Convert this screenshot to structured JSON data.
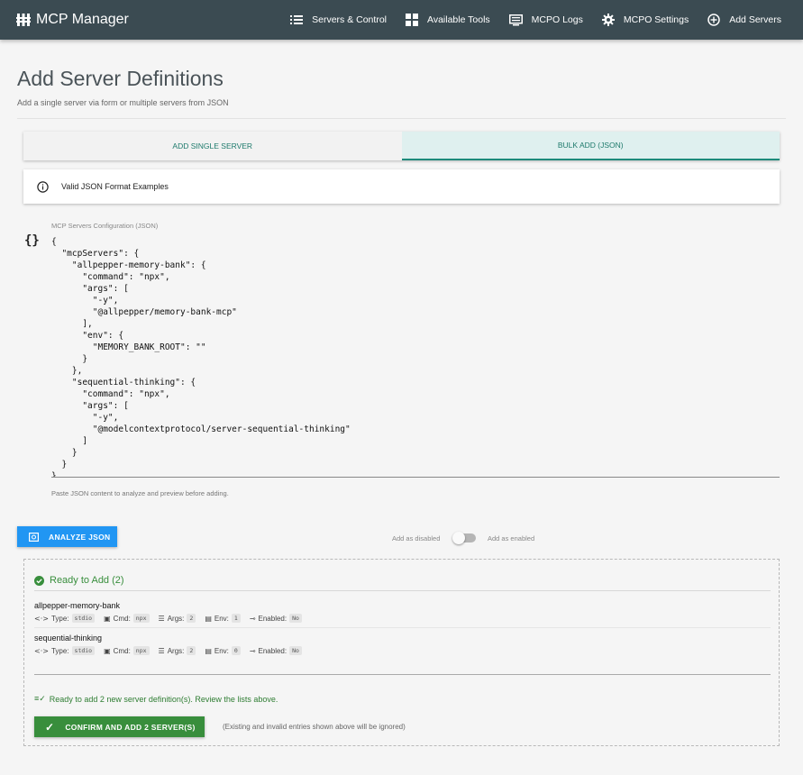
{
  "app": {
    "title": "MCP Manager"
  },
  "nav": [
    {
      "label": "Servers & Control",
      "icon": "list-icon"
    },
    {
      "label": "Available Tools",
      "icon": "widgets-icon"
    },
    {
      "label": "MCPO Logs",
      "icon": "logs-icon"
    },
    {
      "label": "MCPO Settings",
      "icon": "gear-icon"
    },
    {
      "label": "Add Servers",
      "icon": "add-circle-icon"
    }
  ],
  "page": {
    "title": "Add Server Definitions",
    "subtitle": "Add a single server via form or multiple servers from JSON"
  },
  "tabs": [
    {
      "label": "ADD SINGLE SERVER",
      "active": false
    },
    {
      "label": "BULK ADD (JSON)",
      "active": true
    }
  ],
  "info": {
    "text": "Valid JSON Format Examples"
  },
  "json_editor": {
    "label": "MCP Servers Configuration (JSON)",
    "hint": "Paste JSON content to analyze and preview before adding.",
    "lines": [
      "{",
      "  \"mcpServers\": {",
      "    \"allpepper-memory-bank\": {",
      "      \"command\": \"npx\",",
      "      \"args\": [",
      "        \"-y\",",
      "        \"@allpepper/memory-bank-mcp\"",
      "      ],",
      "      \"env\": {",
      "        \"MEMORY_BANK_ROOT\": \"\"",
      "      }",
      "    },",
      "    \"sequential-thinking\": {",
      "      \"command\": \"npx\",",
      "      \"args\": [",
      "        \"-y\",",
      "        \"@modelcontextprotocol/server-sequential-thinking\"",
      "      ]",
      "    }",
      "  }",
      "}"
    ]
  },
  "analyze": {
    "button_label": "ANALYZE JSON",
    "toggle_left": "Add as disabled",
    "toggle_right": "Add as enabled"
  },
  "preview": {
    "title": "Ready to Add (2)",
    "meta_labels": {
      "type": "Type:",
      "cmd": "Cmd:",
      "args": "Args:",
      "env": "Env:",
      "enabled": "Enabled:"
    },
    "servers": [
      {
        "name": "allpepper-memory-bank",
        "type": "stdio",
        "cmd": "npx",
        "args": "2",
        "env": "1",
        "enabled": "No"
      },
      {
        "name": "sequential-thinking",
        "type": "stdio",
        "cmd": "npx",
        "args": "2",
        "env": "0",
        "enabled": "No"
      }
    ],
    "ready_message": "Ready to add 2 new server definition(s). Review the lists above.",
    "confirm_label": "CONFIRM AND ADD 2 SERVER(S)",
    "confirm_note": "(Existing and invalid entries shown above will be ignored)"
  },
  "colors": {
    "topbar": "#3b4b52",
    "accent": "#1e8a7b",
    "primary": "#2196f3",
    "success": "#388e3c"
  }
}
